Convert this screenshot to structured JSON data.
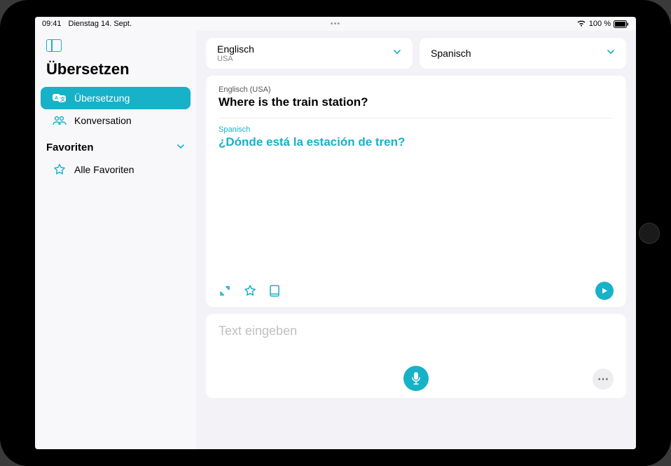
{
  "status": {
    "time": "09:41",
    "date": "Dienstag 14. Sept.",
    "battery": "100 %"
  },
  "sidebar": {
    "title": "Übersetzen",
    "items": [
      {
        "label": "Übersetzung"
      },
      {
        "label": "Konversation"
      }
    ],
    "favorites_header": "Favoriten",
    "favorites_item": "Alle Favoriten"
  },
  "languages": {
    "source": {
      "name": "Englisch",
      "region": "USA"
    },
    "target": {
      "name": "Spanisch"
    }
  },
  "translation": {
    "source_lang_label": "Englisch (USA)",
    "source_text": "Where is the train station?",
    "target_lang_label": "Spanisch",
    "target_text": "¿Dónde está la estación de tren?"
  },
  "input": {
    "placeholder": "Text eingeben"
  },
  "colors": {
    "accent": "#17b1c8"
  }
}
